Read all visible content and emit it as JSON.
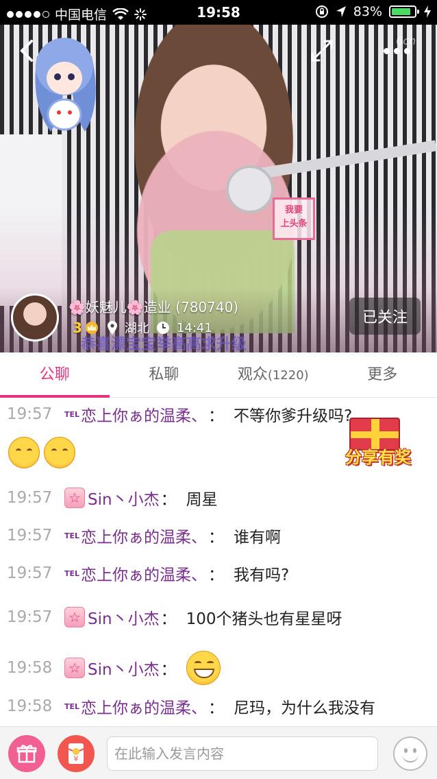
{
  "status_bar": {
    "carrier": "中国电信",
    "time": "19:58",
    "battery": "83%",
    "battery_level": 0.83,
    "icons": [
      "signal-dots-icon",
      "wifi-icon",
      "loading-icon",
      "lock-rotation-icon",
      "location-arrow-icon",
      "battery-icon",
      "charging-icon"
    ]
  },
  "video": {
    "back_icon": "chevron-left-icon",
    "expand_icon": "expand-icon",
    "more_icon": "more-dots-icon",
    "watermark": "6cn",
    "sticker_lines": [
      "我要",
      "上头条"
    ],
    "scroll_text": "恭喜漂宝宝举高高求升级"
  },
  "host": {
    "name": "🌸妖魅儿🌸造业 (780740)",
    "level": "3",
    "location": "湖北",
    "duration": "14:41",
    "follow_label": "已关注"
  },
  "tabs": [
    {
      "label": "公聊",
      "count": "",
      "active": true
    },
    {
      "label": "私聊",
      "count": "",
      "active": false
    },
    {
      "label": "观众",
      "count": "(1220)",
      "active": false
    },
    {
      "label": "更多",
      "count": "",
      "active": false
    }
  ],
  "chat": {
    "messages": [
      {
        "time": "19:57",
        "badge": "TEL",
        "user": "恋上你ぁ的温柔、",
        "colon": "：",
        "text": "不等你爹升级吗?"
      },
      {
        "time": "19:57",
        "badge": "star",
        "user": "Sin丶小杰",
        "colon": "：",
        "text": "周星"
      },
      {
        "time": "19:57",
        "badge": "TEL",
        "user": "恋上你ぁ的温柔、",
        "colon": "：",
        "text": "谁有啊"
      },
      {
        "time": "19:57",
        "badge": "TEL",
        "user": "恋上你ぁ的温柔、",
        "colon": "：",
        "text": "我有吗?"
      },
      {
        "time": "19:57",
        "badge": "star",
        "user": "Sin丶小杰",
        "colon": "：",
        "text": "100个猪头也有星星呀"
      },
      {
        "time": "19:58",
        "badge": "star",
        "user": "Sin丶小杰",
        "colon": "：",
        "text": ""
      },
      {
        "time": "19:58",
        "badge": "TEL",
        "user": "恋上你ぁ的温柔、",
        "colon": "：",
        "text": "尼玛，为什么我没有"
      }
    ],
    "emoji_line_icons": [
      "blush-emoji-icon",
      "blush-emoji-icon"
    ],
    "grin_icon": "grin-emoji-icon",
    "promo_label": "分享有奖"
  },
  "input_bar": {
    "placeholder": "在此输入发言内容",
    "gift_icon": "gift-icon",
    "redpack_icon": "red-envelope-icon",
    "emoji_icon": "smiley-icon",
    "redpack_symbol": "¥"
  },
  "colors": {
    "accent": "#e8327c",
    "username": "#7a2f8f",
    "timestamp": "#aaaaaa"
  }
}
